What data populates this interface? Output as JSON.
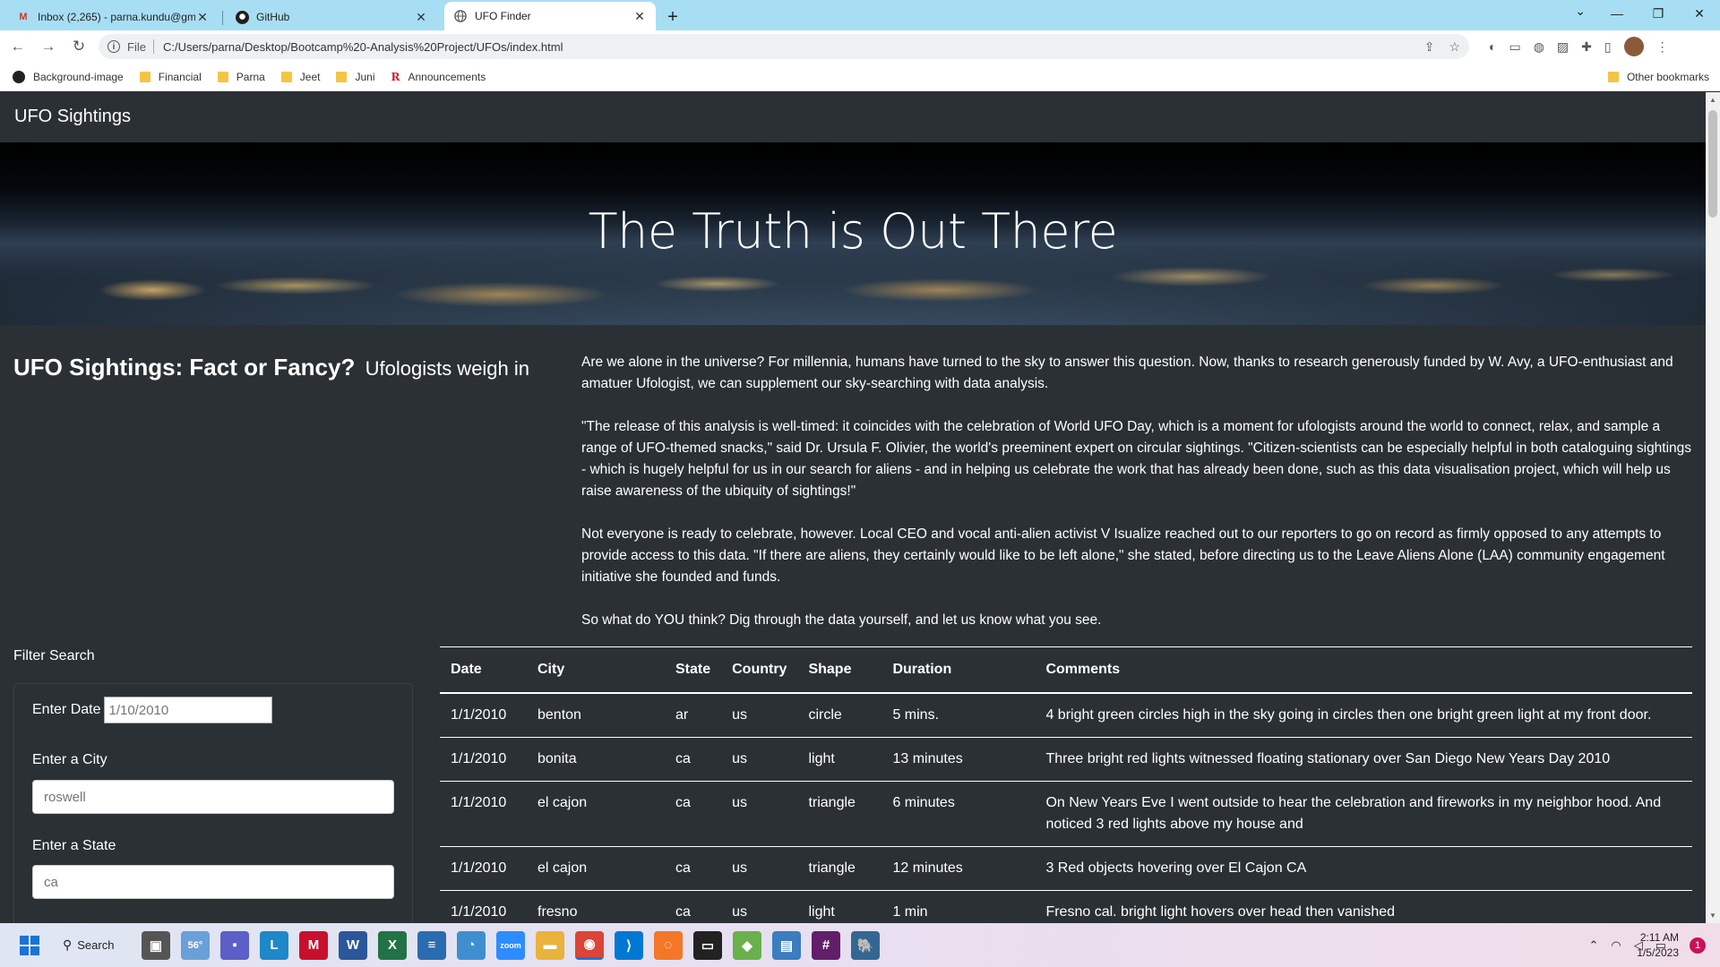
{
  "browser": {
    "tabs": [
      {
        "title": "Inbox (2,265) - parna.kundu@gm",
        "icon": "gmail-icon"
      },
      {
        "title": "GitHub",
        "icon": "github-icon"
      },
      {
        "title": "UFO Finder",
        "icon": "globe-icon"
      }
    ],
    "address": {
      "scheme_label": "File",
      "url": "C:/Users/parna/Desktop/Bootcamp%20-Analysis%20Project/UFOs/index.html"
    },
    "bookmarks": [
      {
        "label": "Background-image",
        "icon": "github-icon"
      },
      {
        "label": "Financial",
        "icon": "folder-icon"
      },
      {
        "label": "Parna",
        "icon": "folder-icon"
      },
      {
        "label": "Jeet",
        "icon": "folder-icon"
      },
      {
        "label": "Juni",
        "icon": "folder-icon"
      },
      {
        "label": "Announcements",
        "icon": "r-icon"
      }
    ],
    "other_bookmarks": "Other bookmarks"
  },
  "page": {
    "brand": "UFO Sightings",
    "hero_title": "The Truth is Out There",
    "headline": "UFO Sightings: Fact or Fancy?",
    "headline_sub": "Ufologists weigh in",
    "article": [
      "Are we alone in the universe? For millennia, humans have turned to the sky to answer this question. Now, thanks to research generously funded by W. Avy, a UFO-enthusiast and amatuer Ufologist, we can supplement our sky-searching with data analysis.",
      "\"The release of this analysis is well-timed: it coincides with the celebration of World UFO Day, which is a moment for ufologists around the world to connect, relax, and sample a range of UFO-themed snacks,\" said Dr. Ursula F. Olivier, the world's preeminent expert on circular sightings. \"Citizen-scientists can be especially helpful in both cataloguing sightings - which is hugely helpful for us in our search for aliens - and in helping us celebrate the work that has already been done, such as this data visualisation project, which will help us raise awareness of the ubiquity of sightings!\"",
      "Not everyone is ready to celebrate, however. Local CEO and vocal anti-alien activist V Isualize reached out to our reporters to go on record as firmly opposed to any attempts to provide access to this data. \"If there are aliens, they certainly would like to be left alone,\" she stated, before directing us to the Leave Aliens Alone (LAA) community engagement initiative she founded and funds.",
      "So what do YOU think? Dig through the data yourself, and let us know what you see."
    ],
    "filter": {
      "title": "Filter Search",
      "date_label": "Enter Date",
      "date_placeholder": "1/10/2010",
      "city_label": "Enter a City",
      "city_placeholder": "roswell",
      "state_label": "Enter a State",
      "state_placeholder": "ca"
    },
    "table": {
      "headers": [
        "Date",
        "City",
        "State",
        "Country",
        "Shape",
        "Duration",
        "Comments"
      ],
      "rows": [
        [
          "1/1/2010",
          "benton",
          "ar",
          "us",
          "circle",
          "5 mins.",
          "4 bright green circles high in the sky going in circles then one bright green light at my front door."
        ],
        [
          "1/1/2010",
          "bonita",
          "ca",
          "us",
          "light",
          "13 minutes",
          "Three bright red lights witnessed floating stationary over San Diego New Years Day 2010"
        ],
        [
          "1/1/2010",
          "el cajon",
          "ca",
          "us",
          "triangle",
          "6 minutes",
          "On New Years Eve I went outside to hear the celebration and fireworks in my neighbor hood. And noticed 3 red lights above my house and"
        ],
        [
          "1/1/2010",
          "el cajon",
          "ca",
          "us",
          "triangle",
          "12 minutes",
          "3 Red objects hovering over El Cajon CA"
        ],
        [
          "1/1/2010",
          "fresno",
          "ca",
          "us",
          "light",
          "1 min",
          "Fresno cal. bright light hovers over head then vanished"
        ]
      ]
    }
  },
  "taskbar": {
    "search_label": "Search",
    "weather": "56°",
    "time": "2:11 AM",
    "date": "1/5/2023",
    "notifications": "1"
  }
}
